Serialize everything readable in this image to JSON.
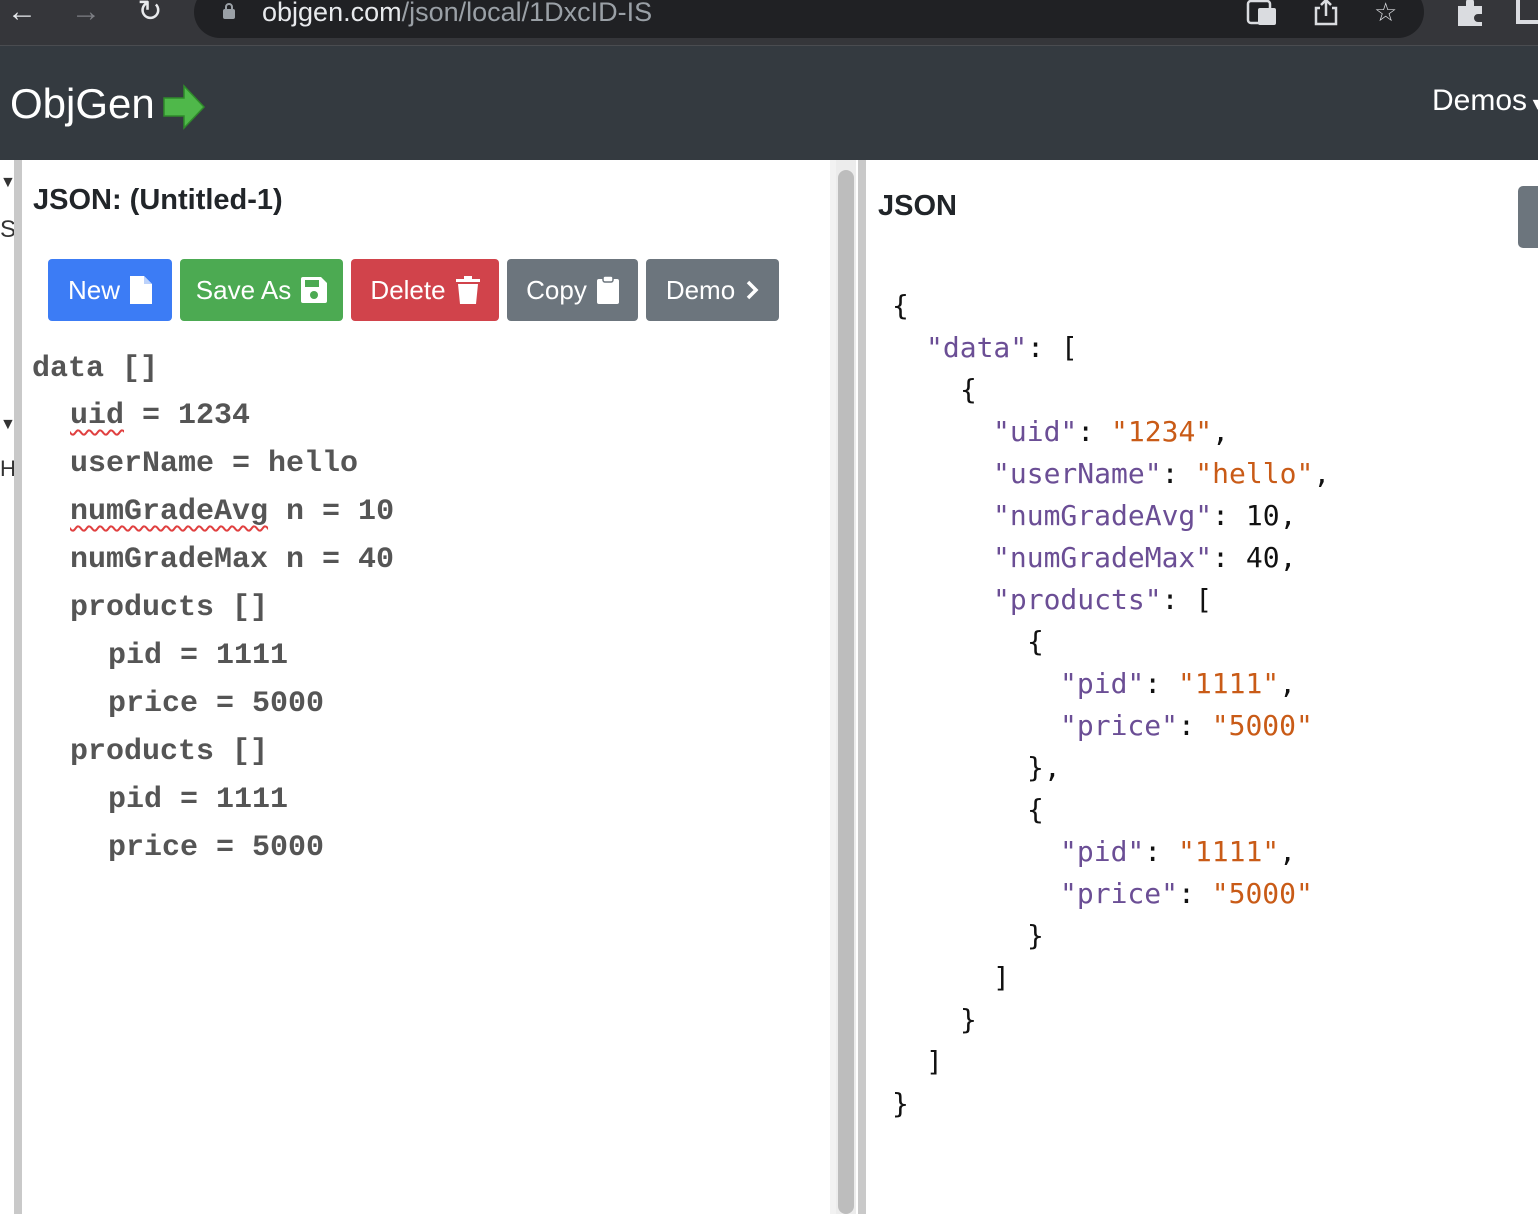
{
  "browser": {
    "url_host": "objgen.com",
    "url_path": "/json/local/1DxcID-IS",
    "icons": [
      "back-arrow-icon",
      "forward-arrow-icon",
      "reload-icon",
      "lock-icon",
      "translate-icon",
      "share-icon",
      "bookmark-star-icon",
      "extensions-puzzle-icon"
    ]
  },
  "navbar": {
    "brand": "ObjGen",
    "demos_label": "Demos"
  },
  "left_sliver": [
    "S",
    "H"
  ],
  "editor_panel": {
    "title": "JSON: (Untitled-1)",
    "buttons": {
      "new": "New",
      "save_as": "Save As",
      "delete": "Delete",
      "copy": "Copy",
      "demo": "Demo"
    },
    "lines": [
      "data []",
      "uid = 1234",
      "userName = hello",
      "numGradeAvg n = 10",
      "numGradeMax n = 40",
      "products []",
      "pid = 1111",
      "price = 5000",
      "products []",
      "pid = 1111",
      "price = 5000"
    ],
    "spell_words": [
      "uid",
      "numGradeAvg"
    ]
  },
  "output_panel": {
    "title": "JSON",
    "json": {
      "open_brace": "{",
      "data_key": "\"data\"",
      "data_open": ": [",
      "obj_open": "{",
      "uid_key": "\"uid\"",
      "uid_val": "\"1234\"",
      "username_key": "\"userName\"",
      "username_val": "\"hello\"",
      "avg_key": "\"numGradeAvg\"",
      "avg_val": "10",
      "max_key": "\"numGradeMax\"",
      "max_val": "40",
      "products_key": "\"products\"",
      "products_open": ": [",
      "p1_open": "{",
      "p1_pid_key": "\"pid\"",
      "p1_pid_val": "\"1111\"",
      "p1_price_key": "\"price\"",
      "p1_price_val": "\"5000\"",
      "p1_close": "},",
      "p2_open": "{",
      "p2_pid_key": "\"pid\"",
      "p2_pid_val": "\"1111\"",
      "p2_price_key": "\"price\"",
      "p2_price_val": "\"5000\"",
      "p2_close": "}",
      "products_close": "]",
      "obj_close": "}",
      "data_close": "]",
      "close_brace": "}"
    }
  },
  "colors": {
    "navbar_bg": "#343a40",
    "btn_new": "#3c7cf5",
    "btn_save": "#4caa52",
    "btn_delete": "#d1434b",
    "btn_secondary": "#6c757d",
    "json_key": "#6b4e95",
    "json_string": "#c95b17"
  }
}
